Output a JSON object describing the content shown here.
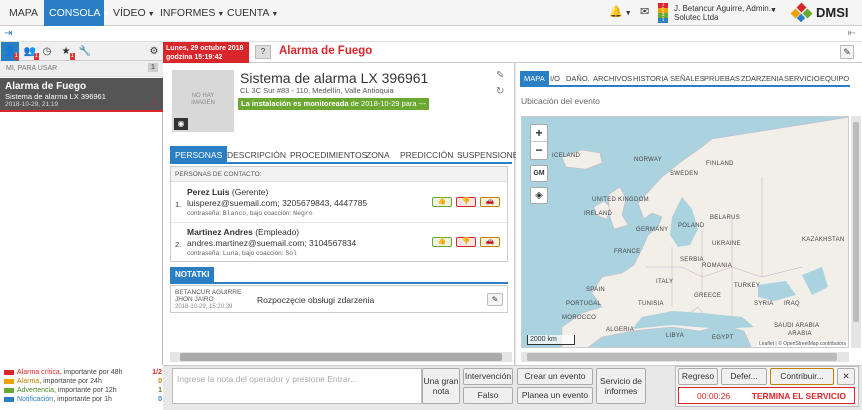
{
  "nav": {
    "items": [
      "MAPA",
      "CONSOLA",
      "VÍDEO",
      "INFORMES",
      "CUENTA"
    ],
    "user_name": "J. Betancur Aguirre, Admin...",
    "company": "Solutec Ltda",
    "logo": "DMSI",
    "status_badges": [
      "1",
      "0",
      "3",
      "1"
    ]
  },
  "left": {
    "section_label": "MI, PARA USAR",
    "section_count": "1",
    "badges": [
      "1",
      "1",
      "1"
    ],
    "alarm": {
      "title": "Alarma de Fuego",
      "system": "Sistema de alarma LX 396961",
      "date": "2018-10-29, 21:19",
      "count": "1"
    },
    "legend": [
      {
        "color": "#d9262b",
        "label": "Alarma crítica",
        "sub": ", importante por 48h",
        "count": "1/2"
      },
      {
        "color": "#f0a000",
        "label": "Alarma",
        "sub": ", importante por 24h",
        "count": "0"
      },
      {
        "color": "#6aa832",
        "label": "Advertencia",
        "sub": ", importante por 12h",
        "count": "1"
      },
      {
        "color": "#2a7fc4",
        "label": "Notificación",
        "sub": ", importante por 1h",
        "count": "0"
      }
    ]
  },
  "event": {
    "date": "Lunes, 29 octubre 2018",
    "time": "godzina 15:19:42",
    "help": "?",
    "title": "Alarma de Fuego"
  },
  "system": {
    "no_image": "NO HAY IMAGEN",
    "name": "Sistema de alarma LX 396961",
    "address": "CL 3C Sur #83 - 110, Medellín, Valle Antioquia",
    "monitor_prefix": "La instalación es monitoreada",
    "monitor_suffix": "de 2018-10-29 para ---"
  },
  "tabs": [
    "PERSONAS",
    "DESCRIPCIÓN",
    "PROCEDIMIENTOS",
    "ZONA",
    "PREDICCIÓN",
    "SUSPENSIONES"
  ],
  "contacts_header": "PERSONAS DE CONTACTO:",
  "contacts": [
    {
      "num": "1.",
      "name": "Perez Luis",
      "role": "(Gerente)",
      "phones": "luisperez@suemail.com; 3205679843, 4447785",
      "pw_label": "contraseña:",
      "pw": "Blanco",
      "coerc_label": ", bajo coacción:",
      "coerc": "Negro"
    },
    {
      "num": "2.",
      "name": "Martinez Andres",
      "role": "(Empleado)",
      "phones": "andres.martinez@suemail.com; 3104567834",
      "pw_label": "contraseña:",
      "pw": "Luna",
      "coerc_label": ", bajo coacción:",
      "coerc": "Sol"
    }
  ],
  "notes": {
    "tab": "NOTATKI",
    "author_l1": "BETANCUR AGUIRRE",
    "author_l2": "JHON JAIRO",
    "date": "2018-10-29, 15:20:39",
    "text": "Rozpoczęcie obsługi zdarzenia"
  },
  "map": {
    "tabs": [
      "MAPA",
      "I/O",
      "DAÑO.",
      "ARCHIVOS",
      "HISTORIA",
      "SEÑALES",
      "PRUEBAS",
      "ZDARZENIA",
      "SERVICIO",
      "EQUIPO"
    ],
    "subtitle": "Ubicación del evento",
    "zoom_in": "+",
    "zoom_out": "−",
    "gm": "GM",
    "scale": "2000 km",
    "attribution": "Leaflet | © OpenStreetMap contributors",
    "labels": [
      "ICELAND",
      "NORWAY",
      "SWEDEN",
      "FINLAND",
      "IRELAND",
      "UNITED KINGDOM",
      "POLAND",
      "BELARUS",
      "UKRAINE",
      "FRANCE",
      "GERMANY",
      "KAZAKHSTAN",
      "SPAIN",
      "ITALY",
      "ROMANIA",
      "TURKEY",
      "GREECE",
      "SYRIA",
      "IRAQ",
      "MOROCCO",
      "ALGERIA",
      "LIBYA",
      "EGYPT",
      "SAUDI ARABIA",
      "ARABIA",
      "TUNISIA",
      "PORTUGAL",
      "SERBIA"
    ]
  },
  "bottom": {
    "note_placeholder": "Ingrese la nota del operador y presione Entrar...",
    "note_button": "Una gran nota",
    "intervencion": "Intervención",
    "falso": "Falso",
    "crear": "Crear un evento",
    "planea": "Planea un evento",
    "servicio": "Servicio de informes",
    "regreso": "Regreso",
    "defer": "Defer...",
    "contribuir": "Contribuir...",
    "close": "✕",
    "timer": "00:00:26",
    "termina": "TERMINA EL SERVICIO"
  }
}
